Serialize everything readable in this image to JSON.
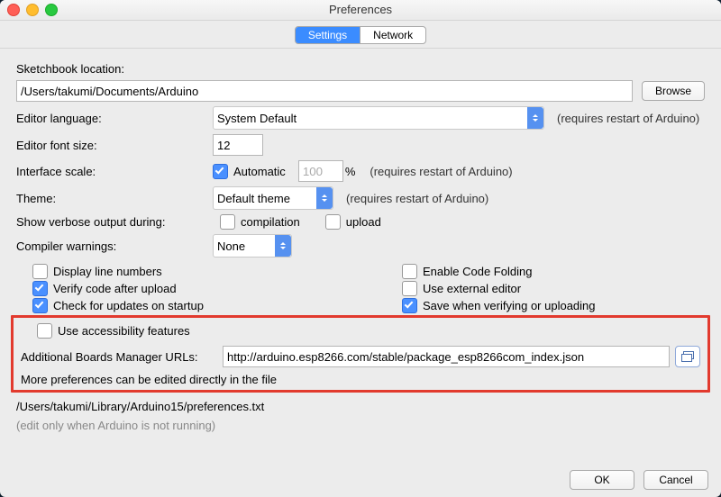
{
  "window": {
    "title": "Preferences"
  },
  "tabs": {
    "settings": "Settings",
    "network": "Network"
  },
  "sketchbook": {
    "label": "Sketchbook location:",
    "value": "/Users/takumi/Documents/Arduino",
    "browse": "Browse"
  },
  "language": {
    "label": "Editor language:",
    "value": "System Default",
    "note": "(requires restart of Arduino)"
  },
  "fontsize": {
    "label": "Editor font size:",
    "value": "12"
  },
  "iscale": {
    "label": "Interface scale:",
    "auto": "Automatic",
    "pct": "100",
    "pctsym": "%",
    "note": "(requires restart of Arduino)"
  },
  "theme": {
    "label": "Theme:",
    "value": "Default theme",
    "note": "(requires restart of Arduino)"
  },
  "verbose": {
    "label": "Show verbose output during:",
    "compile": "compilation",
    "upload": "upload"
  },
  "compwarn": {
    "label": "Compiler warnings:",
    "value": "None"
  },
  "checks": {
    "linenum": "Display line numbers",
    "verify": "Verify code after upload",
    "updates": "Check for updates on startup",
    "access": "Use accessibility features",
    "fold": "Enable Code Folding",
    "extedit": "Use external editor",
    "saveverify": "Save when verifying or uploading"
  },
  "boardsurl": {
    "label": "Additional Boards Manager URLs:",
    "value": "http://arduino.esp8266.com/stable/package_esp8266com_index.json"
  },
  "more": {
    "line1": "More preferences can be edited directly in the file",
    "path": "/Users/takumi/Library/Arduino15/preferences.txt",
    "line3": "(edit only when Arduino is not running)"
  },
  "buttons": {
    "ok": "OK",
    "cancel": "Cancel"
  }
}
